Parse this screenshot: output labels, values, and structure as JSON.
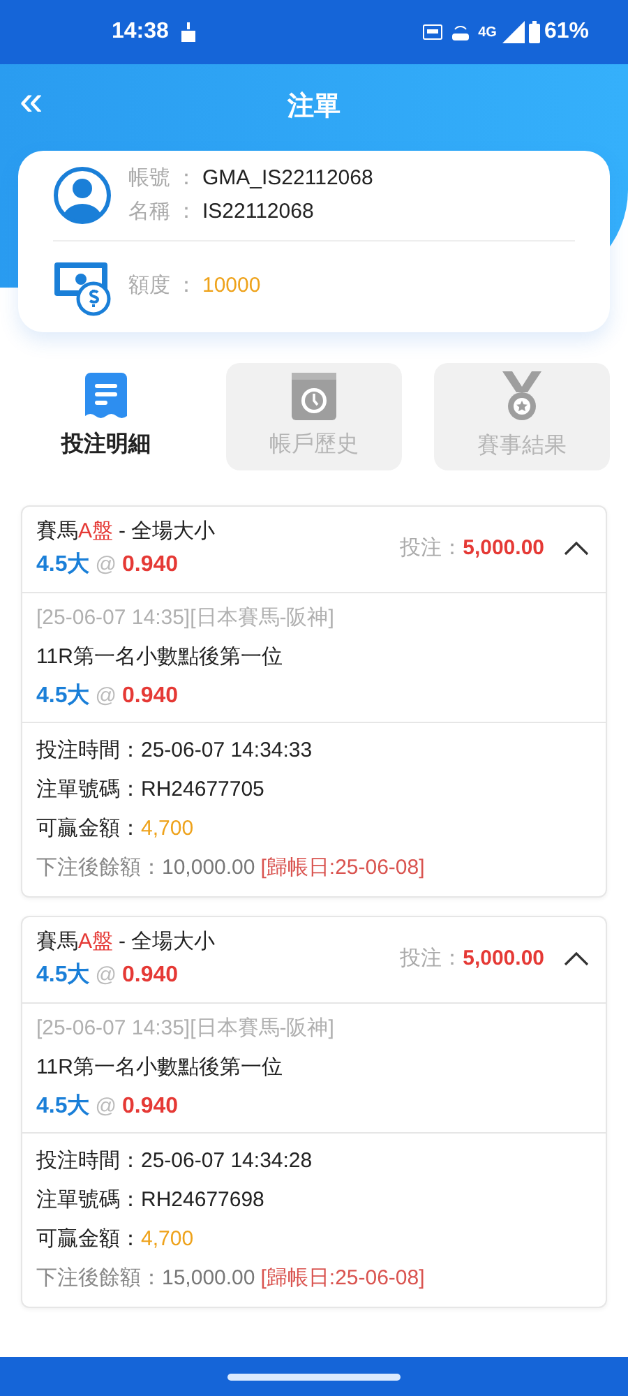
{
  "status_bar": {
    "time": "14:38",
    "battery": "61%",
    "network": "4G"
  },
  "header": {
    "title": "注單",
    "back": "«"
  },
  "account": {
    "fields": [
      {
        "label": "帳號",
        "colon": "：",
        "value": "GMA_IS22112068",
        "kind": "plain"
      },
      {
        "label": "名稱",
        "colon": "：",
        "value": "IS22112068",
        "kind": "plain"
      },
      {
        "label": "額度",
        "colon": "：",
        "value": "10000",
        "kind": "credit"
      }
    ]
  },
  "tabs": [
    {
      "label": "投注明細",
      "selected": true,
      "kind": "list"
    },
    {
      "label": "帳戶歷史",
      "selected": false,
      "kind": "history"
    },
    {
      "label": "賽事結果",
      "selected": false,
      "kind": "medal"
    }
  ],
  "bets": [
    {
      "sport": "賽馬",
      "market_tag": "A盤",
      "market": "- 全場大小",
      "pick": "4.5大",
      "at": "@",
      "odds": "0.940",
      "stake_label": "投注：",
      "stake": "5,000.00",
      "expanded": true,
      "event": "[25-06-07 14:35][日本賽馬-阪神]",
      "selection": "11R第一名小數點後第一位",
      "pick_2": "4.5大",
      "at_2": "@",
      "odds_2": "0.940",
      "details": [
        {
          "label": "投注時間：",
          "value": "25-06-07 14:34:33",
          "kind": "plain"
        },
        {
          "label": "注單號碼：",
          "value": "RH24677705",
          "kind": "plain"
        },
        {
          "label": "可贏金額：",
          "value": "4,700",
          "kind": "win"
        },
        {
          "label": "下注後餘額：",
          "value": "10,000.00",
          "note": "[歸帳日:25-06-08]",
          "kind": "balance"
        }
      ]
    },
    {
      "sport": "賽馬",
      "market_tag": "A盤",
      "market": "- 全場大小",
      "pick": "4.5大",
      "at": "@",
      "odds": "0.940",
      "stake_label": "投注：",
      "stake": "5,000.00",
      "expanded": true,
      "event": "[25-06-07 14:35][日本賽馬-阪神]",
      "selection": "11R第一名小數點後第一位",
      "pick_2": "4.5大",
      "at_2": "@",
      "odds_2": "0.940",
      "details": [
        {
          "label": "投注時間：",
          "value": "25-06-07 14:34:28",
          "kind": "plain"
        },
        {
          "label": "注單號碼：",
          "value": "RH24677698",
          "kind": "plain"
        },
        {
          "label": "可贏金額：",
          "value": "4,700",
          "kind": "win"
        },
        {
          "label": "下注後餘額：",
          "value": "15,000.00",
          "note": "[歸帳日:25-06-08]",
          "kind": "balance"
        }
      ]
    }
  ]
}
